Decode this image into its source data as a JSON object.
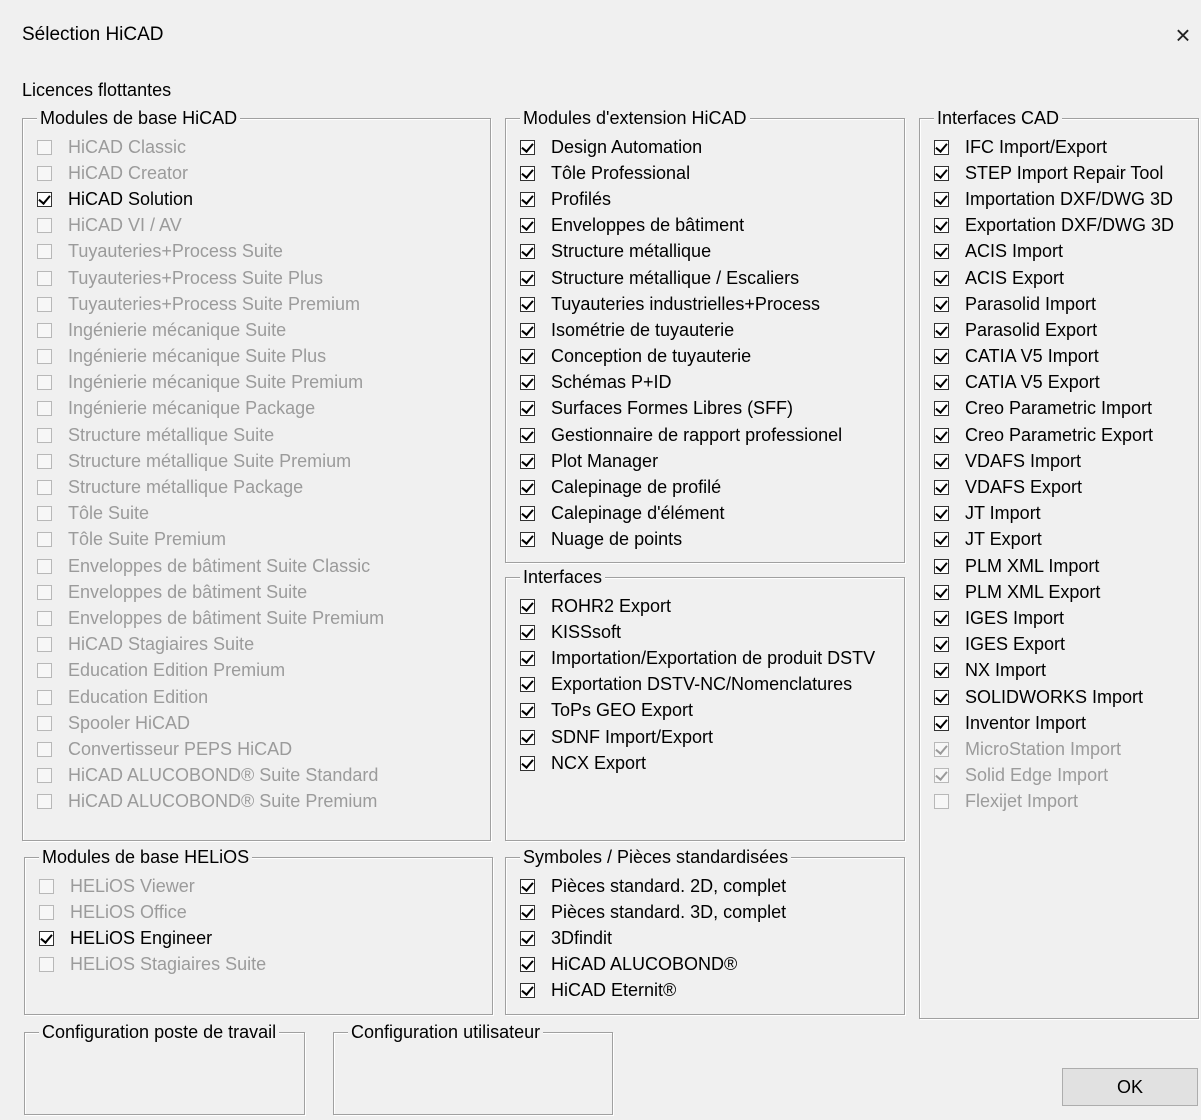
{
  "window": {
    "title": "Sélection HiCAD",
    "close_label": "×"
  },
  "licences_label": "Licences flottantes",
  "groups": {
    "base_hicad": {
      "title": "Modules de base HiCAD",
      "items": [
        {
          "label": "HiCAD Classic",
          "checked": false,
          "enabled": false
        },
        {
          "label": "HiCAD Creator",
          "checked": false,
          "enabled": false
        },
        {
          "label": "HiCAD Solution",
          "checked": true,
          "enabled": true
        },
        {
          "label": "HiCAD VI / AV",
          "checked": false,
          "enabled": false
        },
        {
          "label": "Tuyauteries+Process Suite",
          "checked": false,
          "enabled": false
        },
        {
          "label": "Tuyauteries+Process Suite Plus",
          "checked": false,
          "enabled": false
        },
        {
          "label": "Tuyauteries+Process Suite Premium",
          "checked": false,
          "enabled": false
        },
        {
          "label": "Ingénierie mécanique Suite",
          "checked": false,
          "enabled": false
        },
        {
          "label": "Ingénierie mécanique Suite Plus",
          "checked": false,
          "enabled": false
        },
        {
          "label": "Ingénierie mécanique Suite Premium",
          "checked": false,
          "enabled": false
        },
        {
          "label": "Ingénierie mécanique Package",
          "checked": false,
          "enabled": false
        },
        {
          "label": "Structure métallique Suite",
          "checked": false,
          "enabled": false
        },
        {
          "label": "Structure métallique Suite Premium",
          "checked": false,
          "enabled": false
        },
        {
          "label": "Structure métallique Package",
          "checked": false,
          "enabled": false
        },
        {
          "label": "Tôle Suite",
          "checked": false,
          "enabled": false
        },
        {
          "label": "Tôle Suite Premium",
          "checked": false,
          "enabled": false
        },
        {
          "label": "Enveloppes de bâtiment Suite Classic",
          "checked": false,
          "enabled": false
        },
        {
          "label": "Enveloppes de bâtiment Suite",
          "checked": false,
          "enabled": false
        },
        {
          "label": "Enveloppes de bâtiment Suite Premium",
          "checked": false,
          "enabled": false
        },
        {
          "label": "HiCAD Stagiaires Suite",
          "checked": false,
          "enabled": false
        },
        {
          "label": "Education Edition Premium",
          "checked": false,
          "enabled": false
        },
        {
          "label": "Education Edition",
          "checked": false,
          "enabled": false
        },
        {
          "label": "Spooler HiCAD",
          "checked": false,
          "enabled": false
        },
        {
          "label": "Convertisseur PEPS HiCAD",
          "checked": false,
          "enabled": false
        },
        {
          "label": "HiCAD ALUCOBOND® Suite Standard",
          "checked": false,
          "enabled": false
        },
        {
          "label": "HiCAD ALUCOBOND® Suite Premium",
          "checked": false,
          "enabled": false
        }
      ]
    },
    "base_helios": {
      "title": "Modules de base HELiOS",
      "items": [
        {
          "label": "HELiOS Viewer",
          "checked": false,
          "enabled": false
        },
        {
          "label": "HELiOS Office",
          "checked": false,
          "enabled": false
        },
        {
          "label": "HELiOS Engineer",
          "checked": true,
          "enabled": true
        },
        {
          "label": "HELiOS Stagiaires Suite",
          "checked": false,
          "enabled": false
        }
      ]
    },
    "extension_hicad": {
      "title": "Modules d'extension HiCAD",
      "items": [
        {
          "label": "Design Automation",
          "checked": true,
          "enabled": true
        },
        {
          "label": "Tôle Professional",
          "checked": true,
          "enabled": true
        },
        {
          "label": "Profilés",
          "checked": true,
          "enabled": true
        },
        {
          "label": "Enveloppes de bâtiment",
          "checked": true,
          "enabled": true
        },
        {
          "label": "Structure métallique",
          "checked": true,
          "enabled": true
        },
        {
          "label": "Structure métallique / Escaliers",
          "checked": true,
          "enabled": true
        },
        {
          "label": "Tuyauteries industrielles+Process",
          "checked": true,
          "enabled": true
        },
        {
          "label": "Isométrie de tuyauterie",
          "checked": true,
          "enabled": true
        },
        {
          "label": "Conception de tuyauterie",
          "checked": true,
          "enabled": true
        },
        {
          "label": "Schémas P+ID",
          "checked": true,
          "enabled": true
        },
        {
          "label": "Surfaces Formes Libres (SFF)",
          "checked": true,
          "enabled": true
        },
        {
          "label": "Gestionnaire de rapport professionel",
          "checked": true,
          "enabled": true
        },
        {
          "label": "Plot Manager",
          "checked": true,
          "enabled": true
        },
        {
          "label": "Calepinage de profilé",
          "checked": true,
          "enabled": true
        },
        {
          "label": "Calepinage d'élément",
          "checked": true,
          "enabled": true
        },
        {
          "label": "Nuage de points",
          "checked": true,
          "enabled": true
        }
      ]
    },
    "interfaces": {
      "title": "Interfaces",
      "items": [
        {
          "label": "ROHR2 Export",
          "checked": true,
          "enabled": true
        },
        {
          "label": "KISSsoft",
          "checked": true,
          "enabled": true
        },
        {
          "label": "Importation/Exportation de produit DSTV",
          "checked": true,
          "enabled": true
        },
        {
          "label": "Exportation DSTV-NC/Nomenclatures",
          "checked": true,
          "enabled": true
        },
        {
          "label": "ToPs GEO Export",
          "checked": true,
          "enabled": true
        },
        {
          "label": "SDNF Import/Export",
          "checked": true,
          "enabled": true
        },
        {
          "label": "NCX Export",
          "checked": true,
          "enabled": true
        }
      ]
    },
    "symboles": {
      "title": "Symboles / Pièces standardisées",
      "items": [
        {
          "label": "Pièces standard. 2D, complet",
          "checked": true,
          "enabled": true
        },
        {
          "label": "Pièces standard. 3D, complet",
          "checked": true,
          "enabled": true
        },
        {
          "label": "3Dfindit",
          "checked": true,
          "enabled": true
        },
        {
          "label": "HiCAD ALUCOBOND®",
          "checked": true,
          "enabled": true
        },
        {
          "label": "HiCAD Eternit®",
          "checked": true,
          "enabled": true
        }
      ]
    },
    "cad_interfaces": {
      "title": "Interfaces CAD",
      "items": [
        {
          "label": "IFC Import/Export",
          "checked": true,
          "enabled": true
        },
        {
          "label": "STEP Import Repair Tool",
          "checked": true,
          "enabled": true
        },
        {
          "label": "Importation DXF/DWG 3D",
          "checked": true,
          "enabled": true
        },
        {
          "label": "Exportation DXF/DWG 3D",
          "checked": true,
          "enabled": true
        },
        {
          "label": "ACIS Import",
          "checked": true,
          "enabled": true
        },
        {
          "label": "ACIS Export",
          "checked": true,
          "enabled": true
        },
        {
          "label": "Parasolid Import",
          "checked": true,
          "enabled": true
        },
        {
          "label": "Parasolid Export",
          "checked": true,
          "enabled": true
        },
        {
          "label": "CATIA V5 Import",
          "checked": true,
          "enabled": true
        },
        {
          "label": "CATIA V5 Export",
          "checked": true,
          "enabled": true
        },
        {
          "label": "Creo Parametric Import",
          "checked": true,
          "enabled": true
        },
        {
          "label": "Creo Parametric Export",
          "checked": true,
          "enabled": true
        },
        {
          "label": "VDAFS Import",
          "checked": true,
          "enabled": true
        },
        {
          "label": "VDAFS Export",
          "checked": true,
          "enabled": true
        },
        {
          "label": "JT Import",
          "checked": true,
          "enabled": true
        },
        {
          "label": "JT Export",
          "checked": true,
          "enabled": true
        },
        {
          "label": "PLM XML Import",
          "checked": true,
          "enabled": true
        },
        {
          "label": "PLM XML Export",
          "checked": true,
          "enabled": true
        },
        {
          "label": "IGES Import",
          "checked": true,
          "enabled": true
        },
        {
          "label": "IGES Export",
          "checked": true,
          "enabled": true
        },
        {
          "label": "NX Import",
          "checked": true,
          "enabled": true
        },
        {
          "label": "SOLIDWORKS Import",
          "checked": true,
          "enabled": true
        },
        {
          "label": "Inventor Import",
          "checked": true,
          "enabled": true
        },
        {
          "label": "MicroStation Import",
          "checked": true,
          "enabled": false
        },
        {
          "label": "Solid Edge Import",
          "checked": true,
          "enabled": false
        },
        {
          "label": "Flexijet Import",
          "checked": false,
          "enabled": false
        }
      ]
    },
    "config_poste": {
      "title": "Configuration poste de travail"
    },
    "config_user": {
      "title": "Configuration utilisateur"
    }
  },
  "buttons": {
    "ok": "OK"
  }
}
